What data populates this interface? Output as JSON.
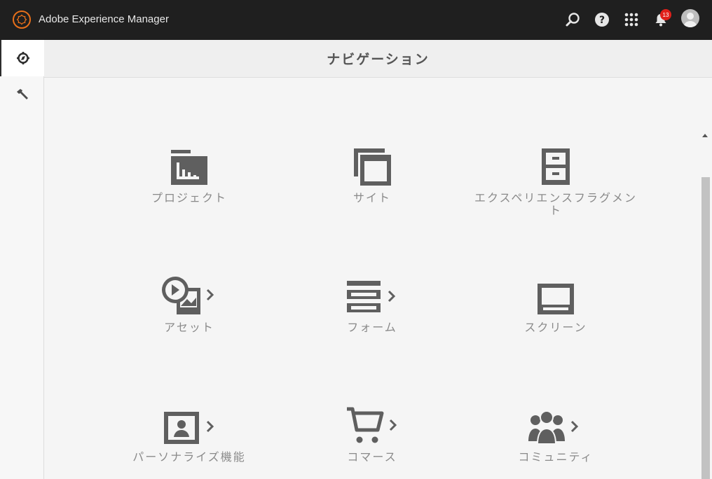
{
  "app": {
    "title": "Adobe Experience Manager"
  },
  "topbar": {
    "notification_count": "13"
  },
  "page": {
    "title": "ナビゲーション"
  },
  "tiles": [
    {
      "label": "プロジェクト",
      "icon": "projects-icon",
      "has_children": false
    },
    {
      "label": "サイト",
      "icon": "sites-icon",
      "has_children": false
    },
    {
      "label": "エクスペリエンスフラグメン\nト",
      "icon": "experience-fragments-icon",
      "has_children": false
    },
    {
      "label": "アセット",
      "icon": "assets-icon",
      "has_children": true
    },
    {
      "label": "フォーム",
      "icon": "forms-icon",
      "has_children": true
    },
    {
      "label": "スクリーン",
      "icon": "screens-icon",
      "has_children": false
    },
    {
      "label": "パーソナライズ機能",
      "icon": "personalization-icon",
      "has_children": true
    },
    {
      "label": "コマース",
      "icon": "commerce-icon",
      "has_children": true
    },
    {
      "label": "コミュニティ",
      "icon": "communities-icon",
      "has_children": true
    }
  ],
  "colors": {
    "topbar": "#1f1f1f",
    "logo_accent": "#e8701a",
    "badge": "#e0201b",
    "icon": "#5f5f5f",
    "label": "#8a8a8a"
  }
}
